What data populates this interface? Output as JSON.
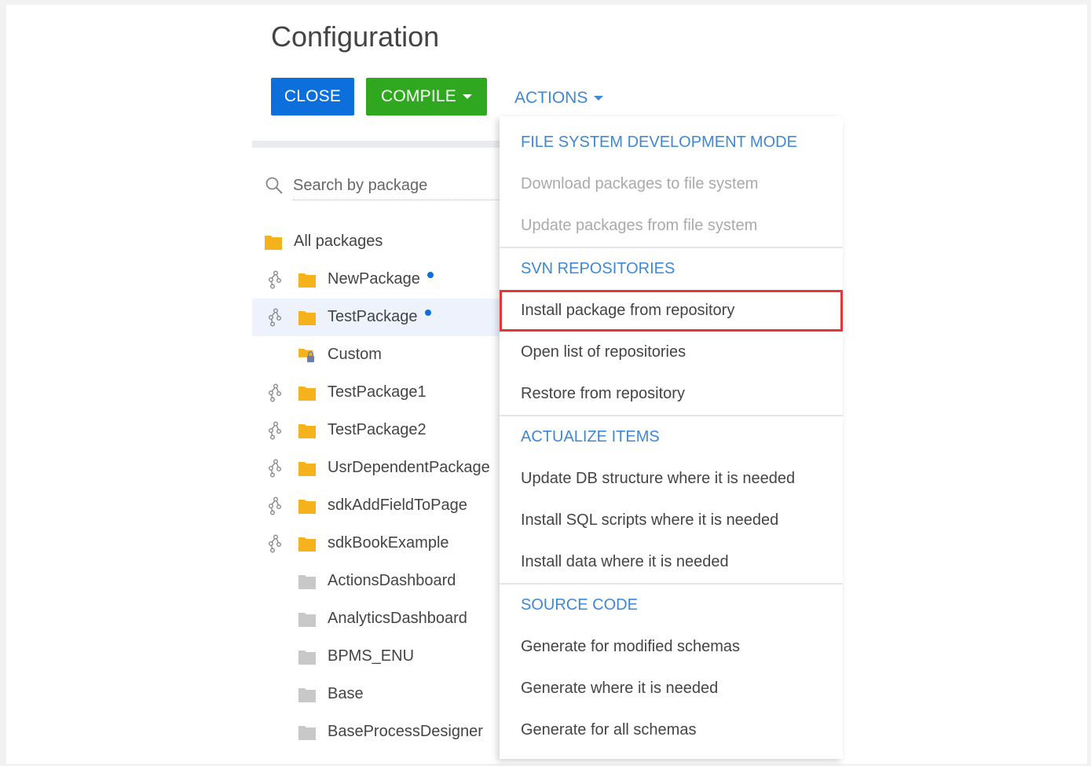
{
  "header": {
    "title": "Configuration",
    "close_label": "CLOSE",
    "compile_label": "COMPILE",
    "actions_label": "ACTIONS"
  },
  "search": {
    "placeholder": "Search by package"
  },
  "tree": {
    "root_label": "All packages",
    "items": [
      {
        "label": "NewPackage",
        "git": true,
        "folder": "yellow",
        "modified": true,
        "selected": false
      },
      {
        "label": "TestPackage",
        "git": true,
        "folder": "yellow",
        "modified": true,
        "selected": true
      },
      {
        "label": "Custom",
        "git": false,
        "folder": "yellow-locked",
        "modified": false,
        "selected": false
      },
      {
        "label": "TestPackage1",
        "git": true,
        "folder": "yellow",
        "modified": false,
        "selected": false
      },
      {
        "label": "TestPackage2",
        "git": true,
        "folder": "yellow",
        "modified": false,
        "selected": false
      },
      {
        "label": "UsrDependentPackage",
        "git": true,
        "folder": "yellow",
        "modified": false,
        "selected": false
      },
      {
        "label": "sdkAddFieldToPage",
        "git": true,
        "folder": "yellow",
        "modified": false,
        "selected": false
      },
      {
        "label": "sdkBookExample",
        "git": true,
        "folder": "yellow",
        "modified": false,
        "selected": false
      },
      {
        "label": "ActionsDashboard",
        "git": false,
        "folder": "gray",
        "modified": false,
        "selected": false
      },
      {
        "label": "AnalyticsDashboard",
        "git": false,
        "folder": "gray",
        "modified": false,
        "selected": false
      },
      {
        "label": "BPMS_ENU",
        "git": false,
        "folder": "gray",
        "modified": false,
        "selected": false
      },
      {
        "label": "Base",
        "git": false,
        "folder": "gray",
        "modified": false,
        "selected": false
      },
      {
        "label": "BaseProcessDesigner",
        "git": false,
        "folder": "gray",
        "modified": false,
        "selected": false
      }
    ]
  },
  "actions_menu": {
    "groups": [
      {
        "header": "FILE SYSTEM DEVELOPMENT MODE",
        "items": [
          {
            "label": "Download packages to file system",
            "disabled": true,
            "highlighted": false
          },
          {
            "label": "Update packages from file system",
            "disabled": true,
            "highlighted": false
          }
        ]
      },
      {
        "header": "SVN REPOSITORIES",
        "items": [
          {
            "label": "Install package from repository",
            "disabled": false,
            "highlighted": true
          },
          {
            "label": "Open list of repositories",
            "disabled": false,
            "highlighted": false
          },
          {
            "label": "Restore from repository",
            "disabled": false,
            "highlighted": false
          }
        ]
      },
      {
        "header": "ACTUALIZE ITEMS",
        "items": [
          {
            "label": "Update DB structure where it is needed",
            "disabled": false,
            "highlighted": false
          },
          {
            "label": "Install SQL scripts where it is needed",
            "disabled": false,
            "highlighted": false
          },
          {
            "label": "Install data where it is needed",
            "disabled": false,
            "highlighted": false
          }
        ]
      },
      {
        "header": "SOURCE CODE",
        "items": [
          {
            "label": "Generate for modified schemas",
            "disabled": false,
            "highlighted": false
          },
          {
            "label": "Generate where it is needed",
            "disabled": false,
            "highlighted": false
          },
          {
            "label": "Generate for all schemas",
            "disabled": false,
            "highlighted": false
          }
        ]
      }
    ]
  },
  "colors": {
    "close_button": "#0d6fdb",
    "compile_button": "#2fa81f",
    "link_blue": "#3e88d5",
    "folder_yellow": "#f5b21c",
    "folder_gray": "#c8c8c8",
    "highlight_red": "#e5363a",
    "modified_dot": "#0d6fdb"
  }
}
